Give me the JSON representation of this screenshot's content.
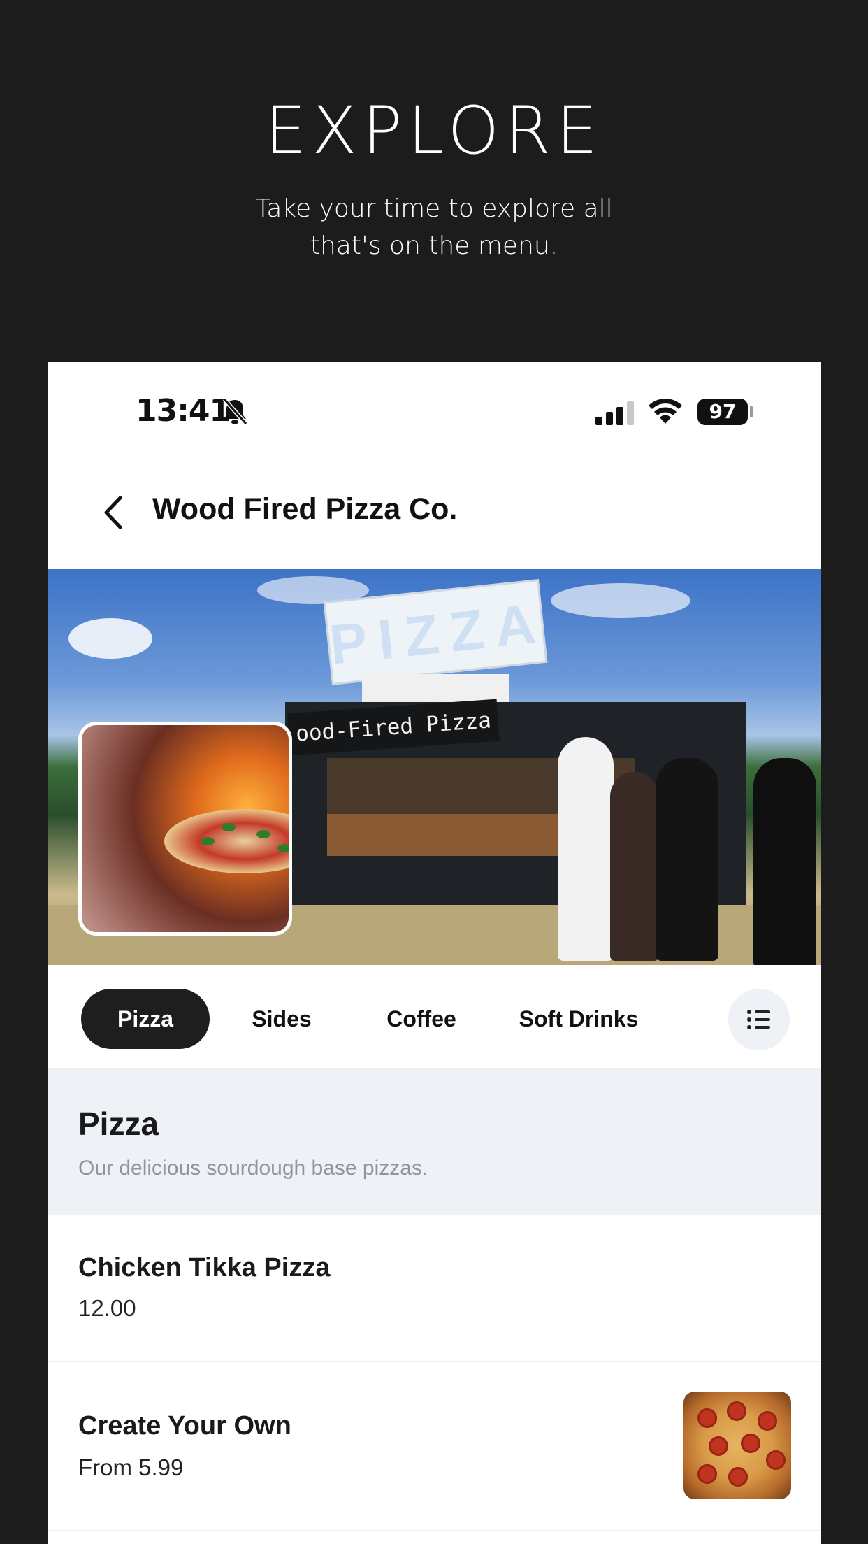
{
  "promo": {
    "title": "EXPLORE",
    "subtitle_line1": "Take your time to explore all",
    "subtitle_line2": "that's on the menu."
  },
  "status_bar": {
    "time": "13:41",
    "battery": "97"
  },
  "nav": {
    "title": "Wood Fired Pizza Co."
  },
  "hero": {
    "banner_text": "ood-Fired Pizza",
    "sign_text": "PIZZA"
  },
  "tabs": [
    {
      "label": "Pizza",
      "active": true
    },
    {
      "label": "Sides",
      "active": false
    },
    {
      "label": "Coffee",
      "active": false
    },
    {
      "label": "Soft Drinks",
      "active": false
    }
  ],
  "section": {
    "title": "Pizza",
    "description": "Our delicious sourdough base pizzas."
  },
  "items": [
    {
      "name": "Chicken Tikka Pizza",
      "price": "12.00"
    },
    {
      "name": "Create Your Own",
      "price": "From 5.99"
    }
  ],
  "icons": {
    "back": "chevron-left-icon",
    "bell": "bell-slash-icon",
    "signal": "cellular-signal-icon",
    "wifi": "wifi-icon",
    "list": "list-icon"
  },
  "colors": {
    "background": "#1c1c1d",
    "active_tab": "#1e1e1e",
    "section_bg": "#eef1f5",
    "muted_text": "#8c96a3"
  }
}
